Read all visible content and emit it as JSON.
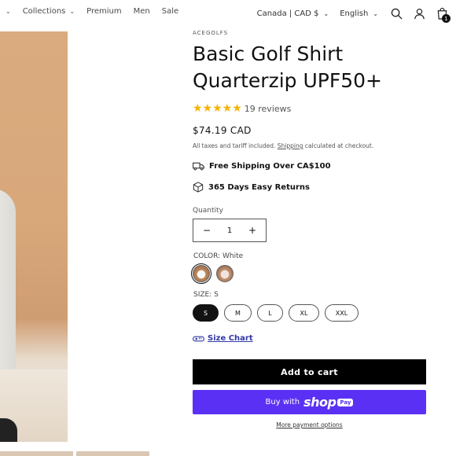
{
  "nav": {
    "items": [
      {
        "label": "",
        "has_chevron": true
      },
      {
        "label": "Collections",
        "has_chevron": true
      },
      {
        "label": "Premium",
        "has_chevron": false
      },
      {
        "label": "Men",
        "has_chevron": false
      },
      {
        "label": "Sale",
        "has_chevron": false
      }
    ],
    "country": "Canada | CAD $",
    "language": "English",
    "cart_count": "1",
    "icons": [
      "search-icon",
      "account-icon",
      "cart-icon"
    ]
  },
  "product": {
    "vendor": "ACEGOLFS",
    "title": "Basic Golf Shirt Quarterzip UPF50+",
    "rating": 5,
    "reviews": "19 reviews",
    "price": "$74.19 CAD",
    "tax_prefix": "All taxes and tariff included.",
    "tax_link": "Shipping",
    "tax_suffix": "calculated at checkout.",
    "perks": [
      {
        "icon": "truck-icon",
        "text": "Free Shipping Over CA$100"
      },
      {
        "icon": "box-icon",
        "text": "365 Days Easy Returns"
      }
    ],
    "quantity_label": "Quantity",
    "quantity_value": "1",
    "color_label": "COLOR: White",
    "size_label": "SIZE: S",
    "sizes": [
      "S",
      "M",
      "L",
      "XL",
      "XXL"
    ],
    "selected_size": "S",
    "size_chart": "Size Chart",
    "add_to_cart": "Add to cart",
    "buy_with": "Buy with",
    "shop_brand": "shop",
    "shop_pay": "Pay",
    "more_payment": "More payment options"
  },
  "colors": {
    "accent_purple": "#5a31f4",
    "star_gold": "#f5b301",
    "link_blue": "#3338a8"
  }
}
